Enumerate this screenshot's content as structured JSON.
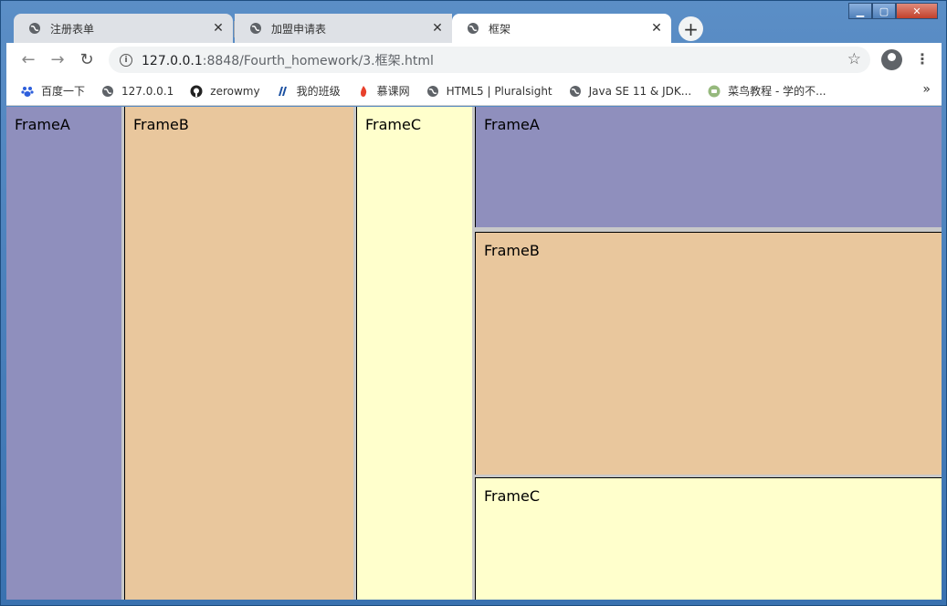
{
  "tabs": [
    {
      "label": "注册表单",
      "active": false
    },
    {
      "label": "加盟申请表",
      "active": false
    },
    {
      "label": "框架",
      "active": true
    }
  ],
  "toolbar": {
    "url_host": "127.0.0.1",
    "url_path": ":8848/Fourth_homework/3.框架.html"
  },
  "bookmarks": [
    {
      "label": "百度一下",
      "icon": "baidu-icon"
    },
    {
      "label": "127.0.0.1",
      "icon": "globe-icon"
    },
    {
      "label": "zerowmy",
      "icon": "github-icon"
    },
    {
      "label": "我的班级",
      "icon": "class-icon"
    },
    {
      "label": "慕课网",
      "icon": "flame-icon"
    },
    {
      "label": "HTML5 | Pluralsight",
      "icon": "globe-icon"
    },
    {
      "label": "Java SE 11 & JDK...",
      "icon": "globe-icon"
    },
    {
      "label": "菜鸟教程 - 学的不...",
      "icon": "runoob-icon"
    }
  ],
  "frames": {
    "left_a": "FrameA",
    "left_b": "FrameB",
    "left_c": "FrameC",
    "right_a": "FrameA",
    "right_b": "FrameB",
    "right_c": "FrameC"
  },
  "colors": {
    "frame_a": "#8f8fbd",
    "frame_b": "#e9c79d",
    "frame_c": "#ffffcc"
  }
}
